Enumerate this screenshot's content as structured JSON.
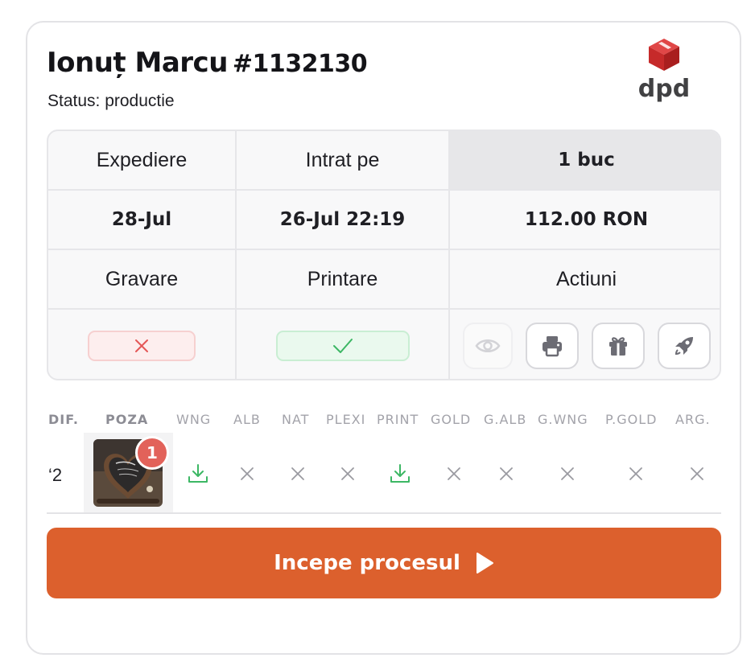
{
  "order": {
    "customer_name": "Ionuț Marcu",
    "order_number": "#1132130",
    "status_text": "Status: productie",
    "courier_logo_text": "dpd"
  },
  "info_table": {
    "headers": [
      "Expediere",
      "Intrat pe",
      "1 buc"
    ],
    "values": [
      "28-Jul",
      "26-Jul 22:19",
      "112.00 RON"
    ],
    "sub_headers": [
      "Gravare",
      "Printare",
      "Actiuni"
    ],
    "gravare_icon": "x-mark",
    "printare_icon": "check-mark"
  },
  "actions": [
    {
      "name": "view",
      "icon": "eye-icon",
      "enabled": false
    },
    {
      "name": "print",
      "icon": "printer-icon",
      "enabled": true
    },
    {
      "name": "gift",
      "icon": "gift-icon",
      "enabled": true
    },
    {
      "name": "ship",
      "icon": "rocket-icon",
      "enabled": true
    }
  ],
  "files": {
    "columns": [
      "DIF.",
      "POZA",
      "WNG",
      "ALB",
      "NAT",
      "PLEXI",
      "PRINT",
      "GOLD",
      "G.ALB",
      "G.WNG",
      "P.GOLD",
      "ARG."
    ],
    "row": {
      "dif": "‘2",
      "photo_badge": "1",
      "cells": [
        "download",
        "none",
        "none",
        "none",
        "download",
        "none",
        "none",
        "none",
        "none",
        "none"
      ]
    }
  },
  "primary_action": {
    "label": "Incepe procesul"
  },
  "colors": {
    "accent": "#dc602d",
    "success": "#3cb764",
    "danger": "#e45757",
    "dpd_red": "#d52b2b"
  }
}
